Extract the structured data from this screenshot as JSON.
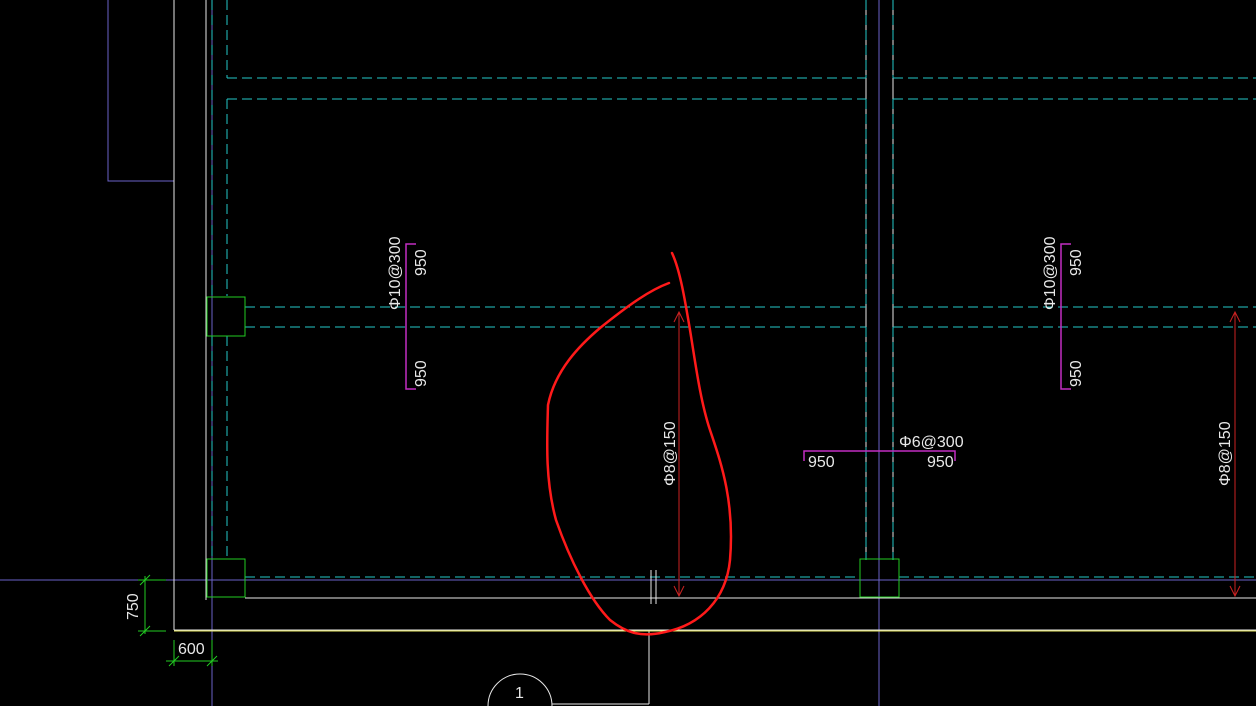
{
  "colors": {
    "background": "#000000",
    "wall_white": "#e8e8e8",
    "dashed_cyan": "#25c7c7",
    "grid_purple": "#6a62c8",
    "column_green": "#22cc22",
    "dimension_green": "#22cc22",
    "rebar_magenta": "#c22ec2",
    "rebar_red": "#cc2222",
    "yellow_line": "#e8e860",
    "markup_red": "#ff1a1a",
    "text_white": "#e8e8e8"
  },
  "annotations": {
    "rebar_top_left": "Φ10@300",
    "rebar_top_left_upper_len": "950",
    "rebar_top_left_lower_len": "950",
    "rebar_top_right": "Φ10@300",
    "rebar_top_right_upper_len": "950",
    "rebar_top_right_lower_len": "950",
    "rebar_horizontal": "Φ6@300",
    "rebar_horizontal_left_len": "950",
    "rebar_horizontal_right_len": "950",
    "rebar_vertical_center": "Φ8@150",
    "rebar_vertical_right": "Φ8@150",
    "dim_vertical": "750",
    "dim_horizontal": "600",
    "axis_bubble": "1"
  },
  "icons": {
    "markup_curve": "red-freehand-curve-icon",
    "axis_bubble": "axis-bubble-icon"
  }
}
